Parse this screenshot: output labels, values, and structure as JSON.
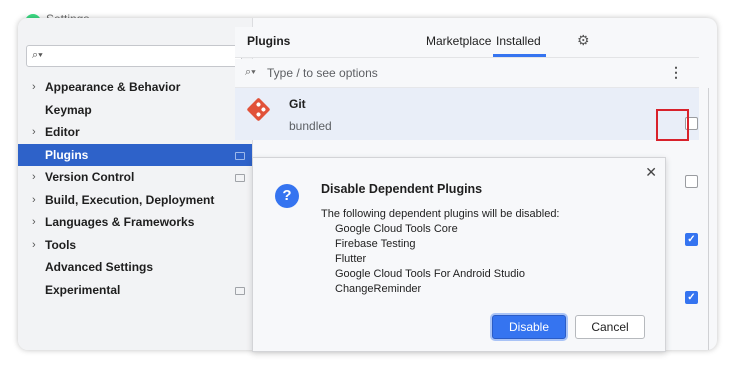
{
  "window": {
    "title": "Settings"
  },
  "sidebar": {
    "search_placeholder": "",
    "items": [
      {
        "label": "Appearance & Behavior",
        "expandable": true
      },
      {
        "label": "Keymap",
        "expandable": false
      },
      {
        "label": "Editor",
        "expandable": true
      },
      {
        "label": "Plugins",
        "expandable": false,
        "selected": true
      },
      {
        "label": "Version Control",
        "expandable": true
      },
      {
        "label": "Build, Execution, Deployment",
        "expandable": true
      },
      {
        "label": "Languages & Frameworks",
        "expandable": true
      },
      {
        "label": "Tools",
        "expandable": true
      },
      {
        "label": "Advanced Settings",
        "expandable": false
      },
      {
        "label": "Experimental",
        "expandable": false
      }
    ]
  },
  "header": {
    "title": "Plugins",
    "tabs": [
      {
        "label": "Marketplace"
      },
      {
        "label": "Installed",
        "active": true
      }
    ]
  },
  "plugin_search": {
    "placeholder": "Type / to see options"
  },
  "plugins": [
    {
      "name": "Git",
      "subtitle": "bundled",
      "enabled": false
    }
  ],
  "checkboxes": [
    false,
    false,
    true,
    true
  ],
  "dialog": {
    "title": "Disable Dependent Plugins",
    "message": "The following dependent plugins will be disabled:",
    "plugins": [
      "Google Cloud Tools Core",
      "Firebase Testing",
      "Flutter",
      "Google Cloud Tools For Android Studio",
      "ChangeReminder"
    ],
    "primary_button": "Disable",
    "secondary_button": "Cancel"
  },
  "colors": {
    "selection": "#2e62c9",
    "accent": "#3574f0",
    "highlight_box": "#d8212b",
    "git_logo": "#e1523a"
  }
}
